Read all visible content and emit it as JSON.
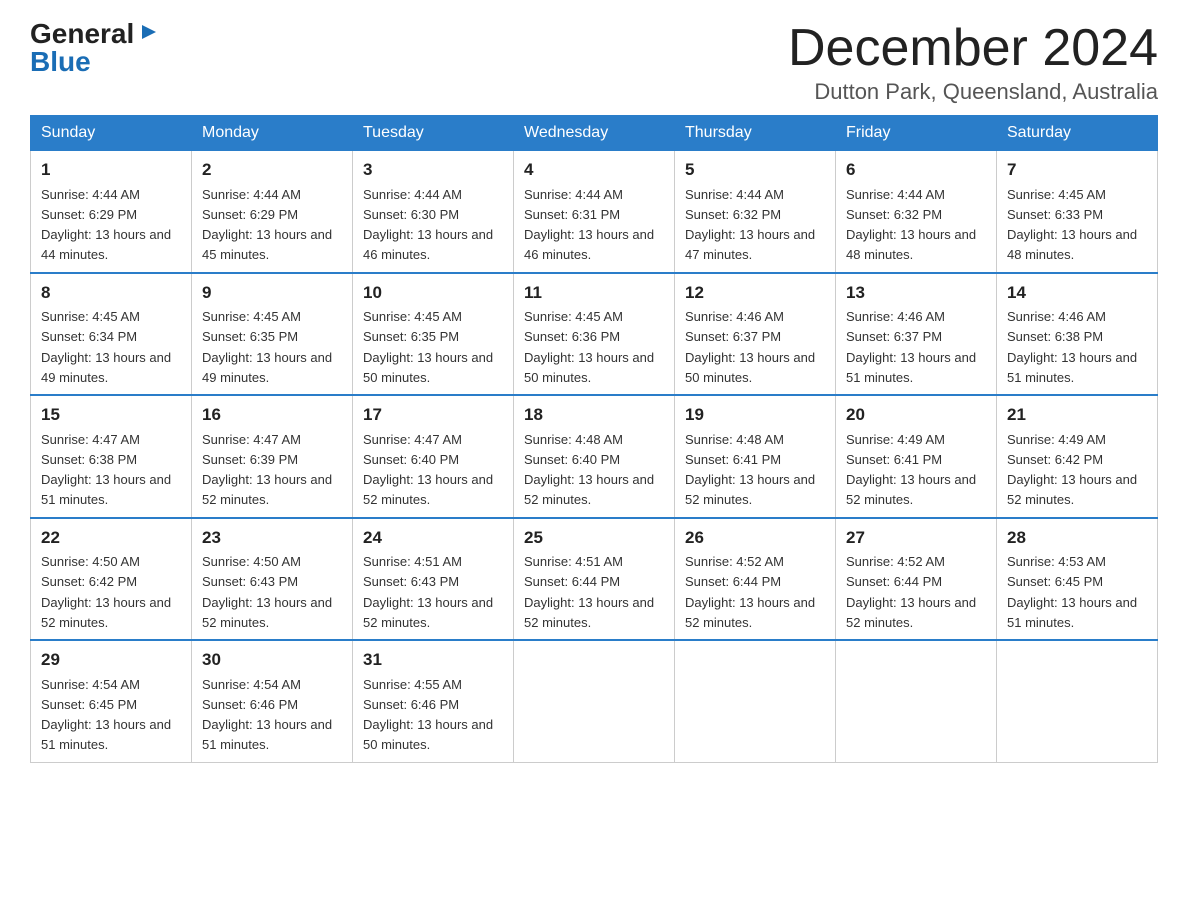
{
  "logo": {
    "general": "General",
    "triangle": "▶",
    "blue": "Blue"
  },
  "title": "December 2024",
  "location": "Dutton Park, Queensland, Australia",
  "headers": [
    "Sunday",
    "Monday",
    "Tuesday",
    "Wednesday",
    "Thursday",
    "Friday",
    "Saturday"
  ],
  "weeks": [
    [
      {
        "day": "1",
        "sunrise": "4:44 AM",
        "sunset": "6:29 PM",
        "daylight": "13 hours and 44 minutes."
      },
      {
        "day": "2",
        "sunrise": "4:44 AM",
        "sunset": "6:29 PM",
        "daylight": "13 hours and 45 minutes."
      },
      {
        "day": "3",
        "sunrise": "4:44 AM",
        "sunset": "6:30 PM",
        "daylight": "13 hours and 46 minutes."
      },
      {
        "day": "4",
        "sunrise": "4:44 AM",
        "sunset": "6:31 PM",
        "daylight": "13 hours and 46 minutes."
      },
      {
        "day": "5",
        "sunrise": "4:44 AM",
        "sunset": "6:32 PM",
        "daylight": "13 hours and 47 minutes."
      },
      {
        "day": "6",
        "sunrise": "4:44 AM",
        "sunset": "6:32 PM",
        "daylight": "13 hours and 48 minutes."
      },
      {
        "day": "7",
        "sunrise": "4:45 AM",
        "sunset": "6:33 PM",
        "daylight": "13 hours and 48 minutes."
      }
    ],
    [
      {
        "day": "8",
        "sunrise": "4:45 AM",
        "sunset": "6:34 PM",
        "daylight": "13 hours and 49 minutes."
      },
      {
        "day": "9",
        "sunrise": "4:45 AM",
        "sunset": "6:35 PM",
        "daylight": "13 hours and 49 minutes."
      },
      {
        "day": "10",
        "sunrise": "4:45 AM",
        "sunset": "6:35 PM",
        "daylight": "13 hours and 50 minutes."
      },
      {
        "day": "11",
        "sunrise": "4:45 AM",
        "sunset": "6:36 PM",
        "daylight": "13 hours and 50 minutes."
      },
      {
        "day": "12",
        "sunrise": "4:46 AM",
        "sunset": "6:37 PM",
        "daylight": "13 hours and 50 minutes."
      },
      {
        "day": "13",
        "sunrise": "4:46 AM",
        "sunset": "6:37 PM",
        "daylight": "13 hours and 51 minutes."
      },
      {
        "day": "14",
        "sunrise": "4:46 AM",
        "sunset": "6:38 PM",
        "daylight": "13 hours and 51 minutes."
      }
    ],
    [
      {
        "day": "15",
        "sunrise": "4:47 AM",
        "sunset": "6:38 PM",
        "daylight": "13 hours and 51 minutes."
      },
      {
        "day": "16",
        "sunrise": "4:47 AM",
        "sunset": "6:39 PM",
        "daylight": "13 hours and 52 minutes."
      },
      {
        "day": "17",
        "sunrise": "4:47 AM",
        "sunset": "6:40 PM",
        "daylight": "13 hours and 52 minutes."
      },
      {
        "day": "18",
        "sunrise": "4:48 AM",
        "sunset": "6:40 PM",
        "daylight": "13 hours and 52 minutes."
      },
      {
        "day": "19",
        "sunrise": "4:48 AM",
        "sunset": "6:41 PM",
        "daylight": "13 hours and 52 minutes."
      },
      {
        "day": "20",
        "sunrise": "4:49 AM",
        "sunset": "6:41 PM",
        "daylight": "13 hours and 52 minutes."
      },
      {
        "day": "21",
        "sunrise": "4:49 AM",
        "sunset": "6:42 PM",
        "daylight": "13 hours and 52 minutes."
      }
    ],
    [
      {
        "day": "22",
        "sunrise": "4:50 AM",
        "sunset": "6:42 PM",
        "daylight": "13 hours and 52 minutes."
      },
      {
        "day": "23",
        "sunrise": "4:50 AM",
        "sunset": "6:43 PM",
        "daylight": "13 hours and 52 minutes."
      },
      {
        "day": "24",
        "sunrise": "4:51 AM",
        "sunset": "6:43 PM",
        "daylight": "13 hours and 52 minutes."
      },
      {
        "day": "25",
        "sunrise": "4:51 AM",
        "sunset": "6:44 PM",
        "daylight": "13 hours and 52 minutes."
      },
      {
        "day": "26",
        "sunrise": "4:52 AM",
        "sunset": "6:44 PM",
        "daylight": "13 hours and 52 minutes."
      },
      {
        "day": "27",
        "sunrise": "4:52 AM",
        "sunset": "6:44 PM",
        "daylight": "13 hours and 52 minutes."
      },
      {
        "day": "28",
        "sunrise": "4:53 AM",
        "sunset": "6:45 PM",
        "daylight": "13 hours and 51 minutes."
      }
    ],
    [
      {
        "day": "29",
        "sunrise": "4:54 AM",
        "sunset": "6:45 PM",
        "daylight": "13 hours and 51 minutes."
      },
      {
        "day": "30",
        "sunrise": "4:54 AM",
        "sunset": "6:46 PM",
        "daylight": "13 hours and 51 minutes."
      },
      {
        "day": "31",
        "sunrise": "4:55 AM",
        "sunset": "6:46 PM",
        "daylight": "13 hours and 50 minutes."
      },
      null,
      null,
      null,
      null
    ]
  ]
}
